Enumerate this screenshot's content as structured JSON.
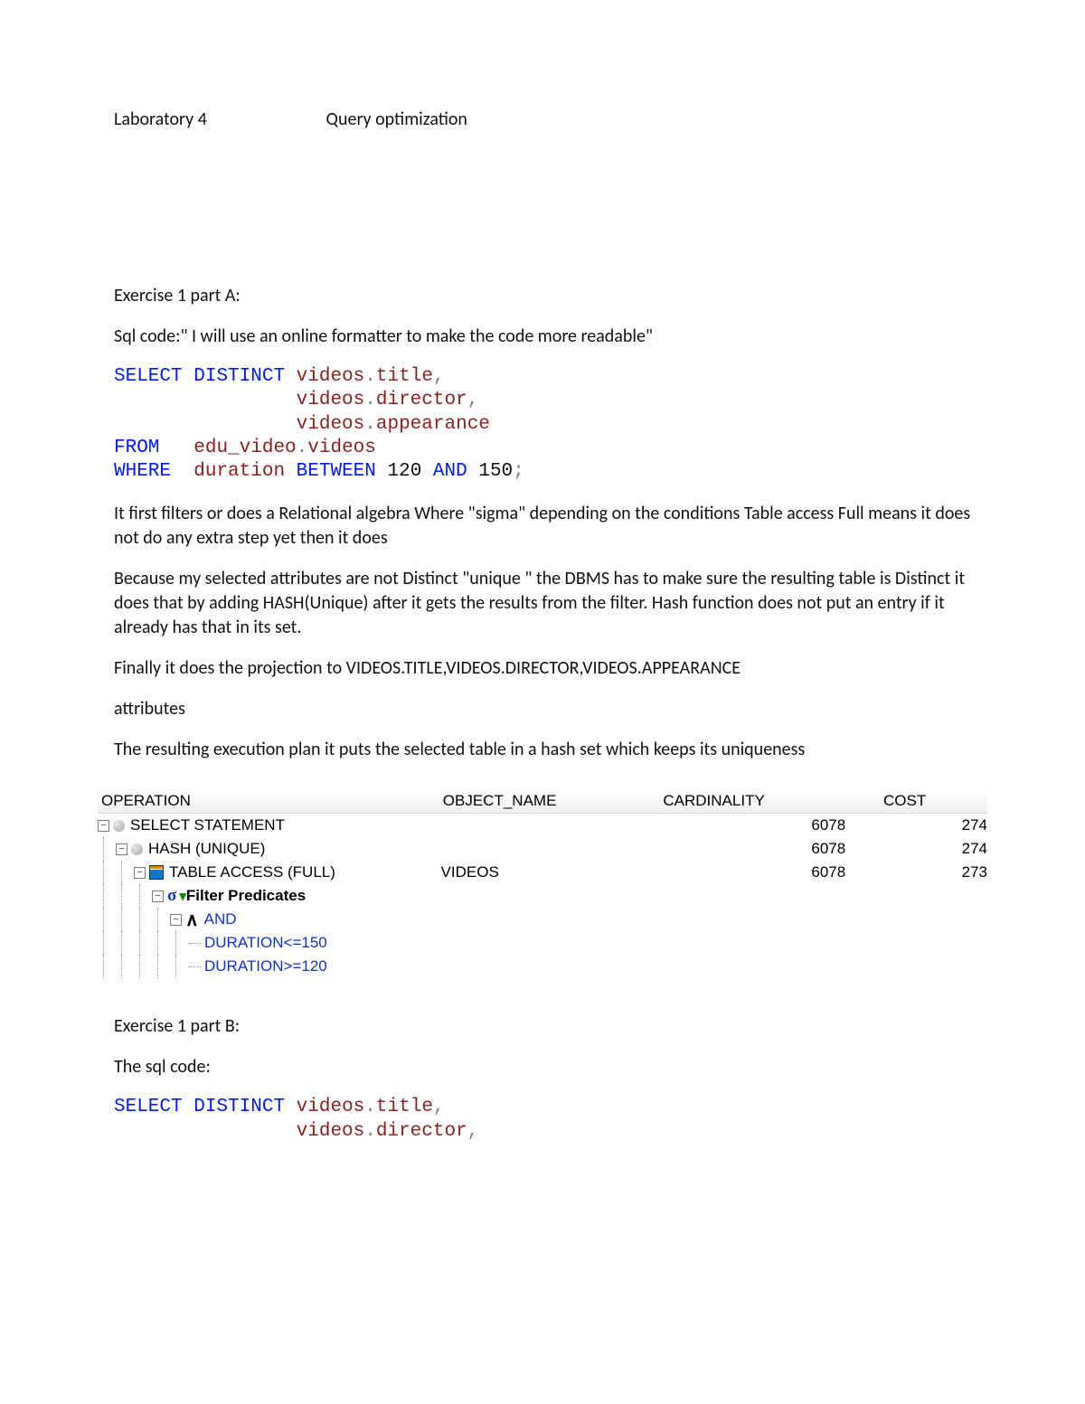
{
  "header": {
    "left": "Laboratory 4",
    "right": "Query optimization"
  },
  "partA": {
    "heading": "Exercise 1 part A:",
    "intro": "Sql code:\" I will use an online formatter to make the code more readable\"",
    "sql": {
      "l1_select": "SELECT",
      "l1_distinct": "DISTINCT",
      "l1_c1_tbl": "videos",
      "l1_c1_col": "title",
      "l2_c2_tbl": "videos",
      "l2_c2_col": "director",
      "l3_c3_tbl": "videos",
      "l3_c3_col": "appearance",
      "l4_from": "FROM",
      "l4_sch": "edu_video",
      "l4_tbl": "videos",
      "l5_where": "WHERE",
      "l5_col": "duration",
      "l5_between": "BETWEEN",
      "l5_v1": "120",
      "l5_and": "AND",
      "l5_v2": "150"
    },
    "p1": "It first filters or does a Relational algebra Where \"sigma\" depending on the conditions Table access Full means it does not do any extra step yet then it does",
    "p2": "Because my selected attributes are not Distinct \"unique \" the DBMS has to make sure the resulting table is Distinct it does that by adding HASH(Unique) after it gets the results from the filter. Hash function does not put an entry if it already has that in its set.",
    "p3": "Finally it does the projection to VIDEOS.TITLE,VIDEOS.DIRECTOR,VIDEOS.APPEARANCE",
    "p4": "attributes",
    "p5": "The resulting execution plan it puts the selected table in a hash set which keeps its uniqueness"
  },
  "plan": {
    "cols": {
      "op": "OPERATION",
      "obj": "OBJECT_NAME",
      "card": "CARDINALITY",
      "cost": "COST"
    },
    "rows": [
      {
        "indent": 0,
        "toggle": "-",
        "icon": "dot",
        "label": "SELECT STATEMENT",
        "obj": "",
        "card": "6078",
        "cost": "274"
      },
      {
        "indent": 1,
        "toggle": "-",
        "icon": "dot",
        "label": "HASH (UNIQUE)",
        "obj": "",
        "card": "6078",
        "cost": "274"
      },
      {
        "indent": 2,
        "toggle": "-",
        "icon": "grid",
        "label": "TABLE ACCESS (FULL)",
        "obj": "VIDEOS",
        "card": "6078",
        "cost": "273"
      },
      {
        "indent": 3,
        "toggle": "-",
        "icon": "sigma",
        "label": "Filter Predicates",
        "obj": "",
        "card": "",
        "cost": ""
      },
      {
        "indent": 4,
        "toggle": "-",
        "icon": "and",
        "label": "AND",
        "obj": "",
        "card": "",
        "cost": ""
      },
      {
        "indent": 5,
        "toggle": "",
        "icon": "none",
        "label": "DURATION<=150",
        "obj": "",
        "card": "",
        "cost": "",
        "pred": true
      },
      {
        "indent": 5,
        "toggle": "",
        "icon": "none",
        "label": "DURATION>=120",
        "obj": "",
        "card": "",
        "cost": "",
        "pred": true
      }
    ]
  },
  "partB": {
    "heading": "Exercise 1 part B:",
    "intro": "The sql code:",
    "sql": {
      "l1_select": "SELECT",
      "l1_distinct": "DISTINCT",
      "l1_c1_tbl": "videos",
      "l1_c1_col": "title",
      "l2_c2_tbl": "videos",
      "l2_c2_col": "director"
    }
  }
}
